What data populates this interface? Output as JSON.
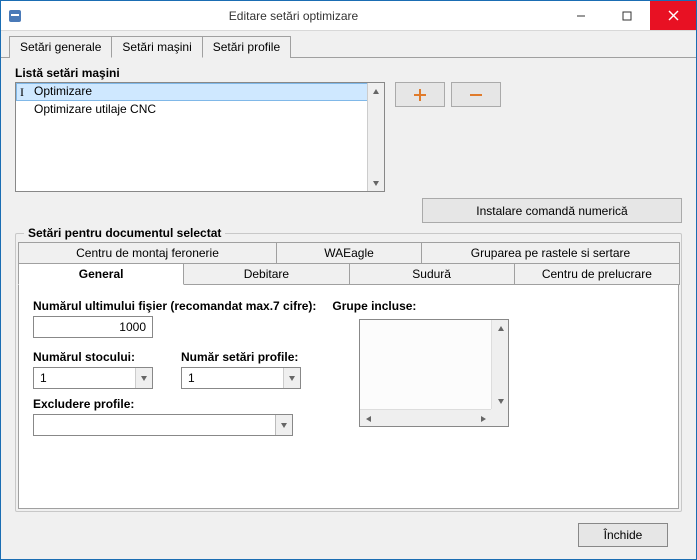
{
  "window": {
    "title": "Editare setări optimizare"
  },
  "top_tabs": [
    {
      "label": "Setări generale",
      "active": false
    },
    {
      "label": "Setări maşini",
      "active": true
    },
    {
      "label": "Setări profile",
      "active": false
    }
  ],
  "machines": {
    "group_label": "Listă setări maşini",
    "items": [
      {
        "label": "Optimizare",
        "selected": true
      },
      {
        "label": "Optimizare utilaje CNC",
        "selected": false
      }
    ]
  },
  "buttons": {
    "install_numeric": "Instalare comandă numerică",
    "close": "Închide"
  },
  "doc": {
    "group_label": "Setări pentru documentul selectat",
    "tabs_top": [
      {
        "label": "Centru de montaj feronerie"
      },
      {
        "label": "WAEagle"
      },
      {
        "label": "Gruparea pe rastele si sertare"
      }
    ],
    "tabs_bottom": [
      {
        "label": "General",
        "active": true
      },
      {
        "label": "Debitare"
      },
      {
        "label": "Sudură"
      },
      {
        "label": "Centru de prelucrare"
      }
    ],
    "general": {
      "last_file_label": "Numărul ultimului fişier (recomandat max.7 cifre):",
      "last_file_value": "1000",
      "stock_label": "Numărul stocului:",
      "stock_value": "1",
      "profile_settings_label": "Număr setări profile:",
      "profile_settings_value": "1",
      "exclude_label": "Excludere profile:",
      "exclude_value": "",
      "groups_label": "Grupe incluse:"
    }
  }
}
